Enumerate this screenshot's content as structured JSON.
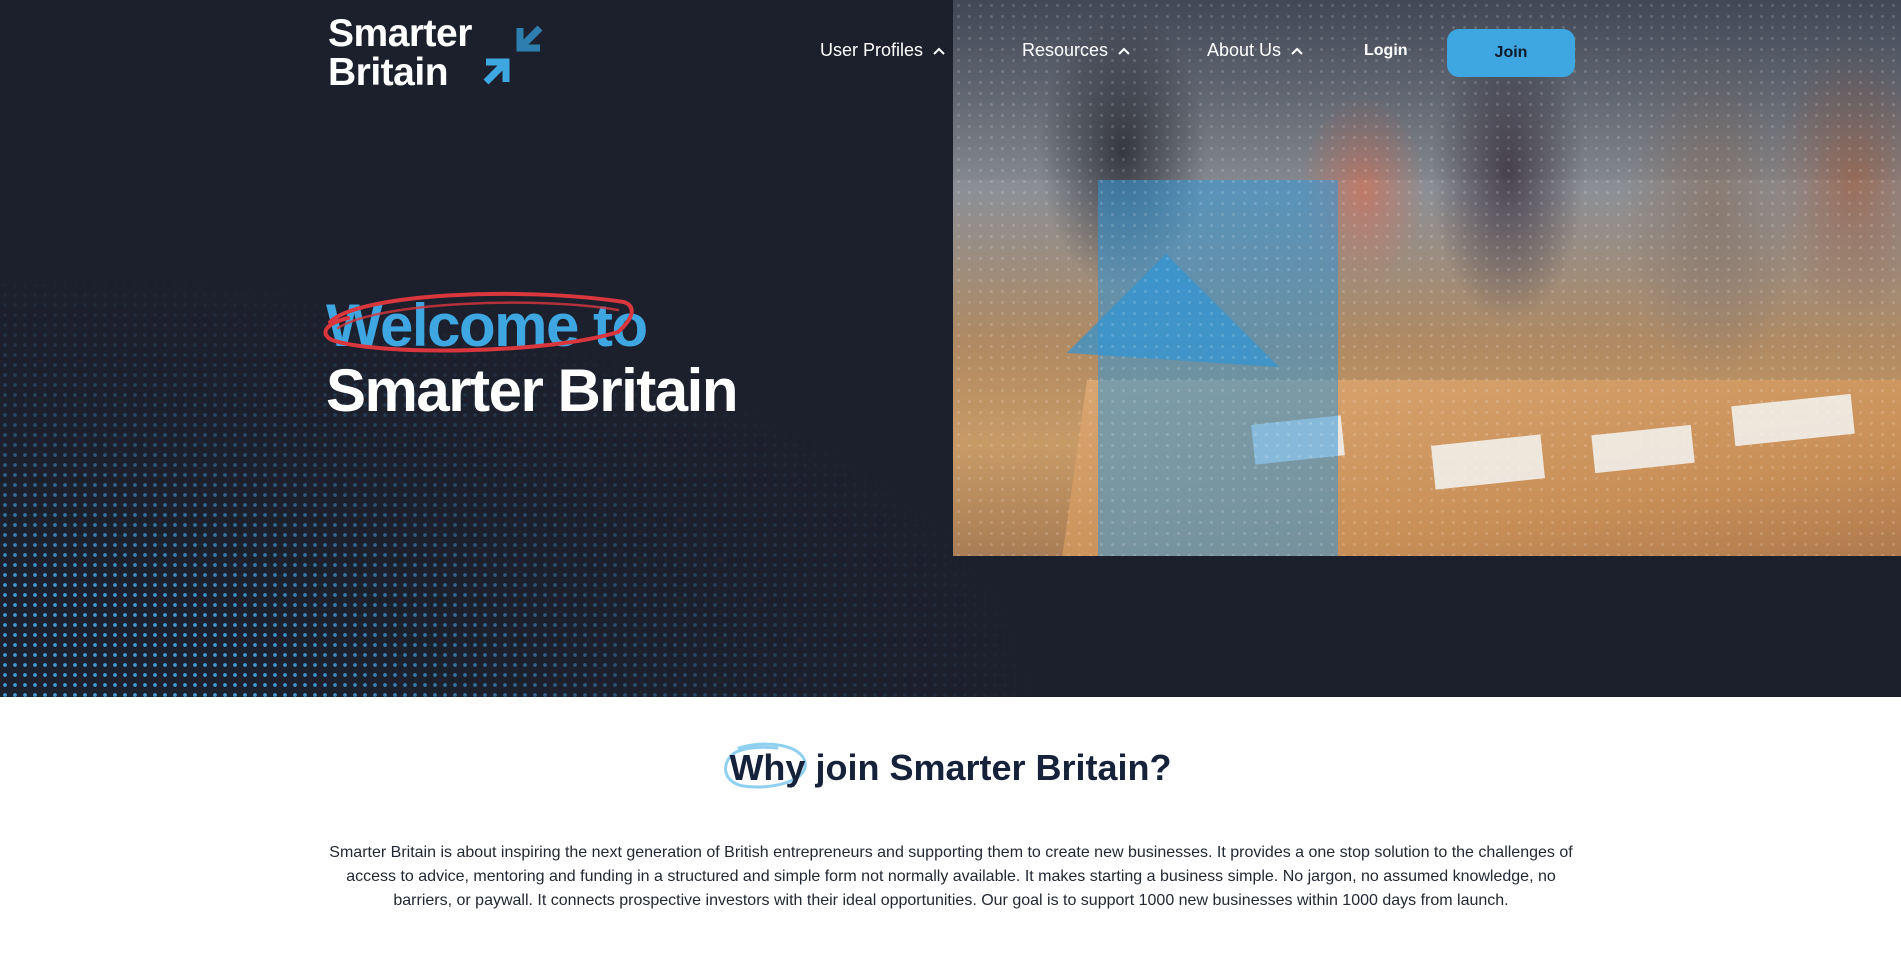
{
  "brand": {
    "logo_line1": "Smarter",
    "logo_line2": "Britain",
    "logo_icon": "inward-arrows-icon",
    "accent_color": "#3ea6e1",
    "hero_bg": "#1c1f2c"
  },
  "nav": {
    "items": [
      {
        "label": "User Profiles",
        "icon": "chevron-up-icon"
      },
      {
        "label": "Resources",
        "icon": "chevron-up-icon"
      },
      {
        "label": "About Us",
        "icon": "chevron-up-icon"
      }
    ],
    "login_label": "Login",
    "join_label": "Join"
  },
  "hero": {
    "title_line1": "Welcome to",
    "title_line2": "Smarter Britain"
  },
  "why": {
    "title_highlight": "Why",
    "title_rest": " join Smarter Britain?",
    "body": "Smarter Britain is about inspiring the next generation of British entrepreneurs and supporting them to create new businesses. It provides a one stop solution to the challenges of access to advice, mentoring and funding in a structured and simple form not normally available. It makes starting a business simple. No jargon, no assumed knowledge, no barriers, or paywall. It connects prospective investors with their ideal opportunities. Our goal is to support 1000 new businesses within 1000 days from launch."
  }
}
